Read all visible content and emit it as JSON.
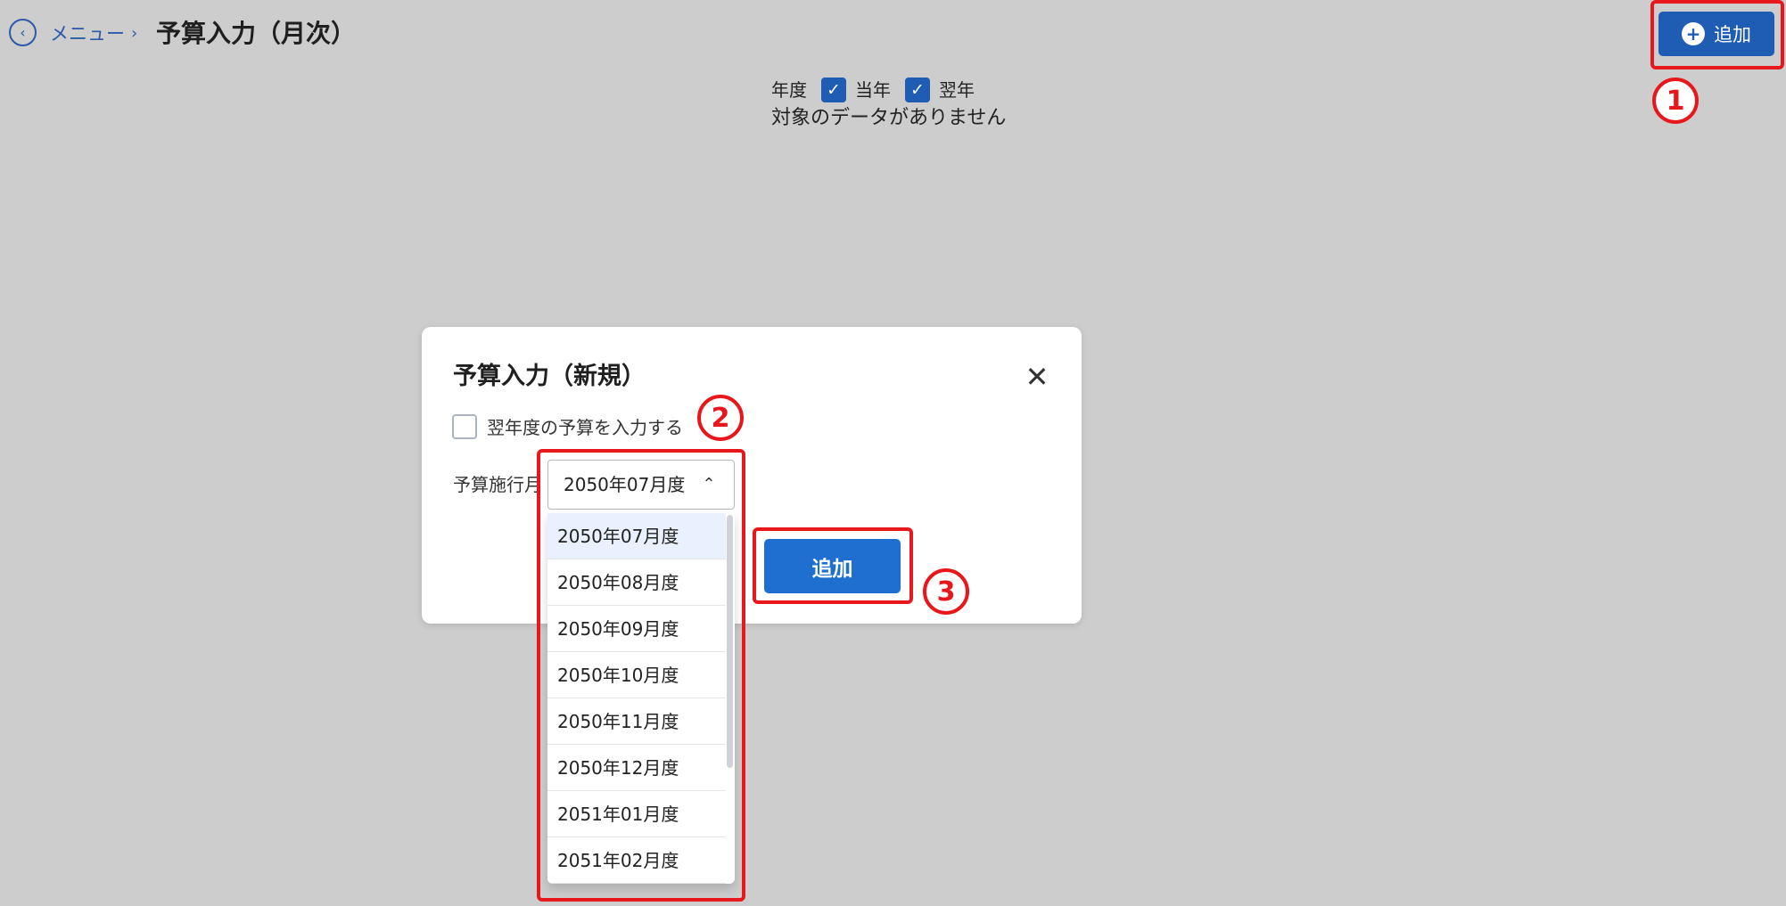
{
  "header": {
    "back_icon": "chevron-left-circle-icon",
    "breadcrumb_menu": "メニュー",
    "breadcrumb_separator": "›",
    "title": "予算入力（月次）",
    "add_button_label": "追加",
    "add_icon": "plus-circle-icon"
  },
  "filter": {
    "fiscal_year_label": "年度",
    "current_year_label": "当年",
    "current_year_checked": true,
    "next_year_label": "翌年",
    "next_year_checked": true,
    "no_data_message": "対象のデータがありません"
  },
  "dialog": {
    "title": "予算入力（新規）",
    "close_icon": "close-icon",
    "next_year_checkbox_label": "翌年度の予算を入力する",
    "next_year_checkbox_checked": false,
    "effective_month_label": "予算施行月",
    "selected_month": "2050年07月度",
    "month_options": [
      "2050年07月度",
      "2050年08月度",
      "2050年09月度",
      "2050年10月度",
      "2050年11月度",
      "2050年12月度",
      "2051年01月度",
      "2051年02月度"
    ],
    "add_button_label": "追加"
  },
  "annotations": {
    "step1": "1",
    "step2": "2",
    "step3": "3",
    "highlight_color": "#e8171c"
  },
  "colors": {
    "primary": "#1f5cb3",
    "dialog_button": "#1f6fd1",
    "overlay": "#cdcdcd",
    "selected_option": "#e8f1fd"
  }
}
